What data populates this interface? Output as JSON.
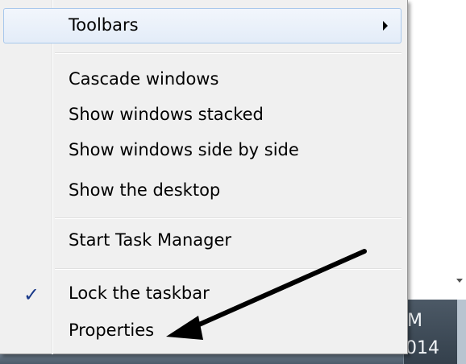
{
  "menu": {
    "items": [
      {
        "label": "Toolbars",
        "has_submenu": true,
        "highlighted": true
      },
      {
        "label": "Cascade windows"
      },
      {
        "label": "Show windows stacked"
      },
      {
        "label": "Show windows side by side"
      },
      {
        "label": "Show the desktop"
      },
      {
        "label": "Start Task Manager"
      },
      {
        "label": "Lock the taskbar",
        "checked": true,
        "check_glyph": "✓"
      },
      {
        "label": "Properties"
      }
    ]
  },
  "taskbar": {
    "clock_time_partial": "M",
    "clock_date_partial": "014"
  },
  "colors": {
    "menu_background": "#f0f0f0",
    "highlight": "#e3ecf8",
    "highlight_border": "#a8c8ec",
    "annotation_arrow": "#000000",
    "checkmark": "#1a3a8a"
  },
  "icons": {
    "submenu": "submenu-arrow-icon",
    "check": "checkmark-icon",
    "annotation": "pointer-arrow-annotation"
  }
}
